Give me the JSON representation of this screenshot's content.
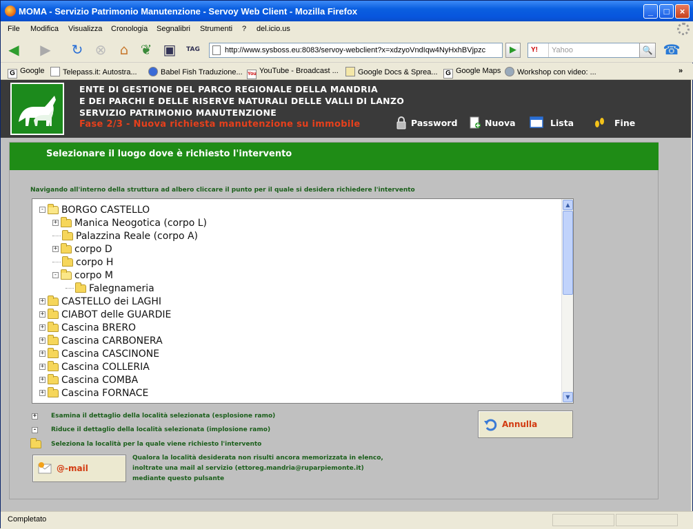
{
  "window": {
    "title": "MOMA - Servizio Patrimonio Manutenzione - Servoy Web Client - Mozilla Firefox"
  },
  "menu": [
    "File",
    "Modifica",
    "Visualizza",
    "Cronologia",
    "Segnalibri",
    "Strumenti",
    "?",
    "del.icio.us"
  ],
  "nav": {
    "url": "http://www.sysboss.eu:8083/servoy-webclient?x=xdzyoVndIqw4NyHxhBVjpzc",
    "search_engine": "Y!",
    "search_placeholder": "Yahoo"
  },
  "bookmarks": [
    {
      "label": "Google",
      "icon": "G"
    },
    {
      "label": "Telepass.it: Autostra...",
      "icon": ""
    },
    {
      "label": "Babel Fish Traduzione...",
      "icon": ""
    },
    {
      "label": "YouTube - Broadcast ...",
      "icon": "You"
    },
    {
      "label": "Google Docs & Sprea...",
      "icon": ""
    },
    {
      "label": "Google Maps",
      "icon": "G"
    },
    {
      "label": "Workshop con video: ...",
      "icon": ""
    }
  ],
  "header": {
    "line1": "ENTE DI GESTIONE DEL PARCO REGIONALE DELLA MANDRIA",
    "line2": "E DEI PARCHI E DELLE RISERVE NATURALI DELLE VALLI DI LANZO",
    "line3": "SERVIZIO PATRIMONIO MANUTENZIONE",
    "phase": "Fase 2/3 - Nuova richiesta manutenzione su immobile",
    "buttons": {
      "password": "Password",
      "nuova": "Nuova",
      "lista": "Lista",
      "fine": "Fine"
    }
  },
  "panel": {
    "title": "Selezionare il luogo dove è richiesto l'intervento",
    "instruction": "Navigando all'interno della struttura ad albero cliccare il punto per il quale si desidera richiedere l'intervento"
  },
  "tree": [
    {
      "label": "BORGO CASTELLO",
      "level": 0,
      "expander": "minus",
      "folder": "open"
    },
    {
      "label": "Manica Neogotica (corpo L)",
      "level": 1,
      "expander": "plus",
      "folder": "closed"
    },
    {
      "label": "Palazzina Reale (corpo A)",
      "level": 1,
      "expander": "none",
      "folder": "closed"
    },
    {
      "label": "corpo D",
      "level": 1,
      "expander": "plus",
      "folder": "closed"
    },
    {
      "label": "corpo H",
      "level": 1,
      "expander": "none",
      "folder": "closed"
    },
    {
      "label": "corpo M",
      "level": 1,
      "expander": "minus",
      "folder": "open"
    },
    {
      "label": "Falegnameria",
      "level": 2,
      "expander": "none",
      "folder": "closed"
    },
    {
      "label": "CASTELLO dei LAGHI",
      "level": 0,
      "expander": "plus",
      "folder": "closed"
    },
    {
      "label": "CIABOT delle GUARDIE",
      "level": 0,
      "expander": "plus",
      "folder": "closed"
    },
    {
      "label": "Cascina BRERO",
      "level": 0,
      "expander": "plus",
      "folder": "closed"
    },
    {
      "label": "Cascina CARBONERA",
      "level": 0,
      "expander": "plus",
      "folder": "closed"
    },
    {
      "label": "Cascina CASCINONE",
      "level": 0,
      "expander": "plus",
      "folder": "closed"
    },
    {
      "label": "Cascina COLLERIA",
      "level": 0,
      "expander": "plus",
      "folder": "closed"
    },
    {
      "label": "Cascina COMBA",
      "level": 0,
      "expander": "plus",
      "folder": "closed"
    },
    {
      "label": "Cascina FORNACE",
      "level": 0,
      "expander": "plus",
      "folder": "closed"
    }
  ],
  "legend": {
    "expand": "Esamina il dettaglio della località selezionata (esplosione ramo)",
    "collapse": "Riduce il dettaglio della località selezionata (implosione ramo)",
    "select": "Seleziona la località per la quale viene richiesto l'intervento"
  },
  "buttons": {
    "annulla": "Annulla",
    "email": "@-mail"
  },
  "mail_note": {
    "line1": "Qualora la località desiderata non risulti ancora memorizzata in elenco,",
    "line2": "inoltrate una mail al servizio (ettoreg.mandria@ruparpiemonte.it)",
    "line3": "mediante questo pulsante"
  },
  "status": {
    "text": "Completato"
  },
  "colors": {
    "green_bar": "#1f8c16",
    "header_bg": "#3a3a3a",
    "phase_red": "#e6401c",
    "legend_green": "#1a5e1a"
  }
}
